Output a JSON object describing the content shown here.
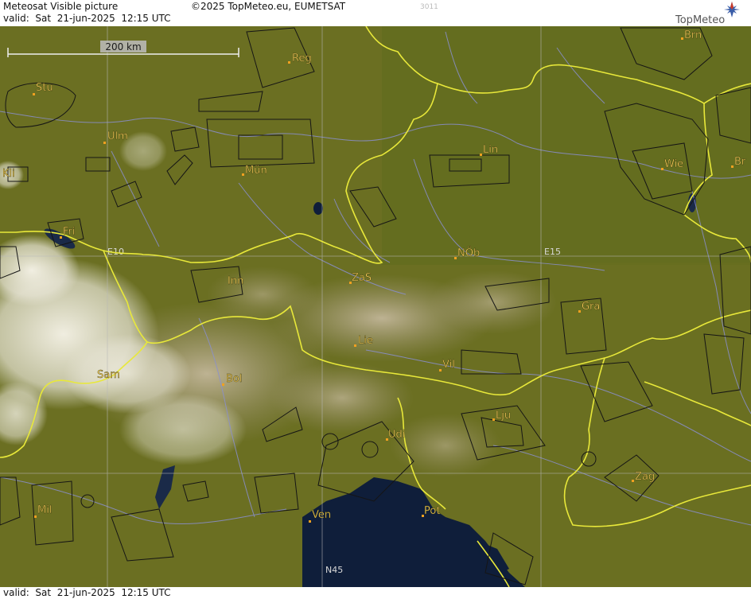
{
  "header": {
    "title": "Meteosat Visible picture",
    "copyright": "©2025 TopMeteo.eu, EUMETSAT",
    "code": "3011",
    "valid": "valid:  Sat  21-jun-2025  12:15 UTC",
    "logo_text": "TopMeteo"
  },
  "footer": {
    "valid": "valid:  Sat  21-jun-2025  12:15 UTC"
  },
  "scale": {
    "label": "200 km"
  },
  "grid_labels": {
    "e10": "E10",
    "e15": "E15",
    "n45": "N45"
  },
  "cities": {
    "brn": "Brn",
    "reg": "Reg",
    "stu": "Stu",
    "ulm": "Ulm",
    "mun": "Mün",
    "lin": "Lin",
    "wie": "Wie",
    "br": "Br",
    "kli": "Kli",
    "fri": "Fri",
    "inn": "Inn",
    "zas": "ZaS",
    "nob": "NÖb",
    "gra": "Gra",
    "lie": "Lie",
    "vil": "Vil",
    "sam": "Sam",
    "bol": "Bol",
    "lju": "Lju",
    "udi": "Udi",
    "zag": "Zag",
    "mil": "Mil",
    "ven": "Ven",
    "pot": "Pot"
  },
  "colors": {
    "land": "#6b6f22",
    "sea": "#0f1e3a",
    "border": "#e8e83a",
    "river": "#8a8fd0",
    "airspace": "#151515",
    "city_dot": "#f0a020",
    "city_label": "#ffd35a",
    "cloud": "#f4f1e6"
  }
}
